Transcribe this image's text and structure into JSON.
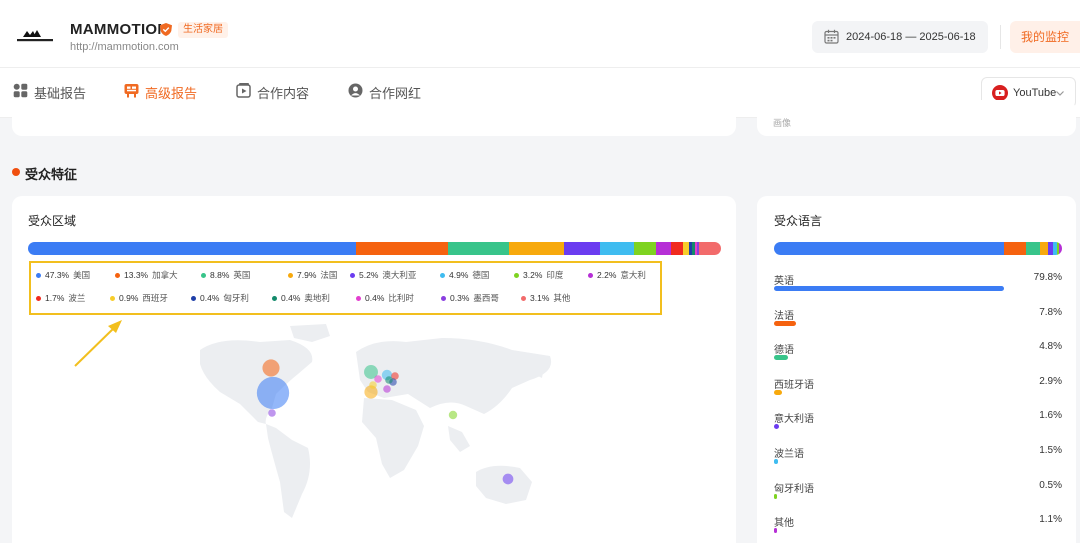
{
  "header": {
    "brand_name": "MAMMOTION",
    "category_badge": "生活家居",
    "url": "http://mammotion.com",
    "date_range": "2024-06-18 — 2025-06-18",
    "monitor_button": "我的监控"
  },
  "tabs": [
    {
      "label": "基础报告",
      "icon": "grid-icon",
      "active": false
    },
    {
      "label": "高级报告",
      "icon": "report-icon",
      "active": true
    },
    {
      "label": "合作内容",
      "icon": "video-icon",
      "active": false
    },
    {
      "label": "合作网红",
      "icon": "person-icon",
      "active": false
    }
  ],
  "platform_select": {
    "value": "YouTube",
    "icon": "youtube-icon"
  },
  "top_stub_text": "画像",
  "section": {
    "title": "受众特征"
  },
  "region": {
    "title": "受众区域",
    "items": [
      {
        "pct": "47.3%",
        "name": "美国",
        "value": 47.3,
        "color": "#3b7cf4"
      },
      {
        "pct": "13.3%",
        "name": "加拿大",
        "value": 13.3,
        "color": "#f5620f"
      },
      {
        "pct": "8.8%",
        "name": "英国",
        "value": 8.8,
        "color": "#38c48a"
      },
      {
        "pct": "7.9%",
        "name": "法国",
        "value": 7.9,
        "color": "#f7a90d"
      },
      {
        "pct": "5.2%",
        "name": "澳大利亚",
        "value": 5.2,
        "color": "#6b3cf0"
      },
      {
        "pct": "4.9%",
        "name": "德国",
        "value": 4.9,
        "color": "#3fbcf0"
      },
      {
        "pct": "3.2%",
        "name": "印度",
        "value": 3.2,
        "color": "#7ed321"
      },
      {
        "pct": "2.2%",
        "name": "意大利",
        "value": 2.2,
        "color": "#b62fd6"
      },
      {
        "pct": "1.7%",
        "name": "波兰",
        "value": 1.7,
        "color": "#f02b1f"
      },
      {
        "pct": "0.9%",
        "name": "西班牙",
        "value": 0.9,
        "color": "#f7cd2a"
      },
      {
        "pct": "0.4%",
        "name": "匈牙利",
        "value": 0.4,
        "color": "#1f3fa8"
      },
      {
        "pct": "0.4%",
        "name": "奥地利",
        "value": 0.4,
        "color": "#138a6b"
      },
      {
        "pct": "0.4%",
        "name": "比利时",
        "value": 0.4,
        "color": "#e33fcf"
      },
      {
        "pct": "0.3%",
        "name": "墨西哥",
        "value": 0.3,
        "color": "#8a3fe0"
      },
      {
        "pct": "3.1%",
        "name": "其他",
        "value": 3.1,
        "color": "#f26b6b"
      }
    ]
  },
  "language": {
    "title": "受众语言",
    "items": [
      {
        "name": "英语",
        "pct": "79.8%",
        "value": 79.8,
        "color": "#3b7cf4"
      },
      {
        "name": "法语",
        "pct": "7.8%",
        "value": 7.8,
        "color": "#f5620f"
      },
      {
        "name": "德语",
        "pct": "4.8%",
        "value": 4.8,
        "color": "#38c48a"
      },
      {
        "name": "西班牙语",
        "pct": "2.9%",
        "value": 2.9,
        "color": "#f7a90d"
      },
      {
        "name": "意大利语",
        "pct": "1.6%",
        "value": 1.6,
        "color": "#6b3cf0"
      },
      {
        "name": "波兰语",
        "pct": "1.5%",
        "value": 1.5,
        "color": "#3fbcf0"
      },
      {
        "name": "匈牙利语",
        "pct": "0.5%",
        "value": 0.5,
        "color": "#7ed321"
      },
      {
        "name": "其他",
        "pct": "1.1%",
        "value": 1.1,
        "color": "#b62fd6"
      }
    ]
  }
}
